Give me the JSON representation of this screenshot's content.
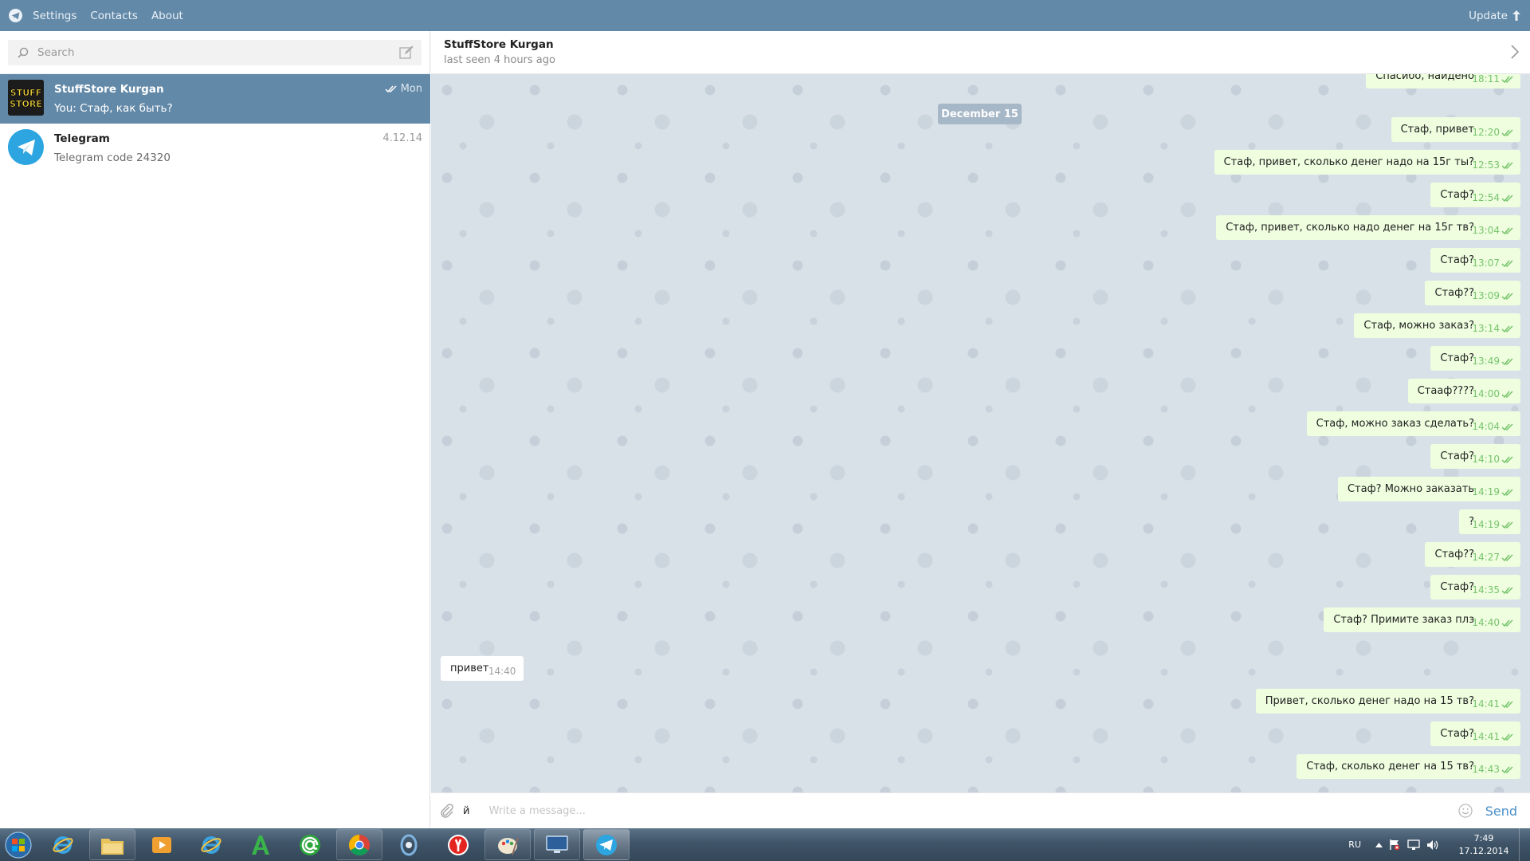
{
  "menu": {
    "items": [
      "Settings",
      "Contacts",
      "About"
    ],
    "update_label": "Update"
  },
  "search": {
    "placeholder": "Search"
  },
  "dialogs": [
    {
      "name": "StuffStore Kurgan",
      "preview": "You: Стаф, как быть?",
      "date": "Mon",
      "avatar_text_1": "STUFF",
      "avatar_text_2": "STORE",
      "active": true
    },
    {
      "name": "Telegram",
      "preview": "Telegram code 24320",
      "date": "4.12.14",
      "active": false
    }
  ],
  "chat": {
    "title": "StuffStore Kurgan",
    "status": "last seen 4 hours ago",
    "date_separator": "December 15",
    "messages": [
      {
        "dir": "out",
        "text": "Спасибо, найдено",
        "time": "18:11"
      },
      {
        "dir": "out",
        "text": "Стаф, привет",
        "time": "12:20"
      },
      {
        "dir": "out",
        "text": "Стаф, привет, сколько денег надо на 15г ты?",
        "time": "12:53"
      },
      {
        "dir": "out",
        "text": "Стаф?",
        "time": "12:54"
      },
      {
        "dir": "out",
        "text": "Стаф, привет, сколько надо денег на 15г тв?",
        "time": "13:04"
      },
      {
        "dir": "out",
        "text": "Стаф?",
        "time": "13:07"
      },
      {
        "dir": "out",
        "text": "Стаф??",
        "time": "13:09"
      },
      {
        "dir": "out",
        "text": "Стаф, можно заказ?",
        "time": "13:14"
      },
      {
        "dir": "out",
        "text": "Стаф?",
        "time": "13:49"
      },
      {
        "dir": "out",
        "text": "Стааф????",
        "time": "14:00"
      },
      {
        "dir": "out",
        "text": "Стаф, можно заказ сделать?",
        "time": "14:04"
      },
      {
        "dir": "out",
        "text": "Стаф?",
        "time": "14:10"
      },
      {
        "dir": "out",
        "text": "Стаф? Можно заказать",
        "time": "14:19"
      },
      {
        "dir": "out",
        "text": "?",
        "time": "14:19"
      },
      {
        "dir": "out",
        "text": "Стаф??",
        "time": "14:27"
      },
      {
        "dir": "out",
        "text": "Стаф?",
        "time": "14:35"
      },
      {
        "dir": "out",
        "text": "Стаф? Примите заказ плз",
        "time": "14:40"
      },
      {
        "dir": "in",
        "text": "привет",
        "time": "14:40"
      },
      {
        "dir": "out",
        "text": "Привет, сколько денег надо на 15 тв?",
        "time": "14:41"
      },
      {
        "dir": "out",
        "text": "Стаф?",
        "time": "14:41"
      },
      {
        "dir": "out",
        "text": "Стаф, сколько денег на 15 тв?",
        "time": "14:43"
      }
    ]
  },
  "composer": {
    "typed_text": "й",
    "placeholder": "Write a message...",
    "send_label": "Send"
  },
  "taskbar": {
    "apps": [
      "start-orb",
      "internet-explorer",
      "file-explorer",
      "media-player",
      "internet-explorer-2",
      "a-app",
      "mail-ru-agent",
      "chrome",
      "qip",
      "yandex-browser",
      "paint",
      "remote-desktop",
      "telegram"
    ],
    "language": "RU",
    "time": "7:49",
    "date": "17.12.2014"
  },
  "colors": {
    "topbar": "#6389a8",
    "active_dialog": "#6389a8",
    "outgoing_bubble": "#eefedf",
    "chat_bg": "#d9e1e8",
    "read_ticks": "#78c46d",
    "send_button": "#4a8fc9"
  }
}
